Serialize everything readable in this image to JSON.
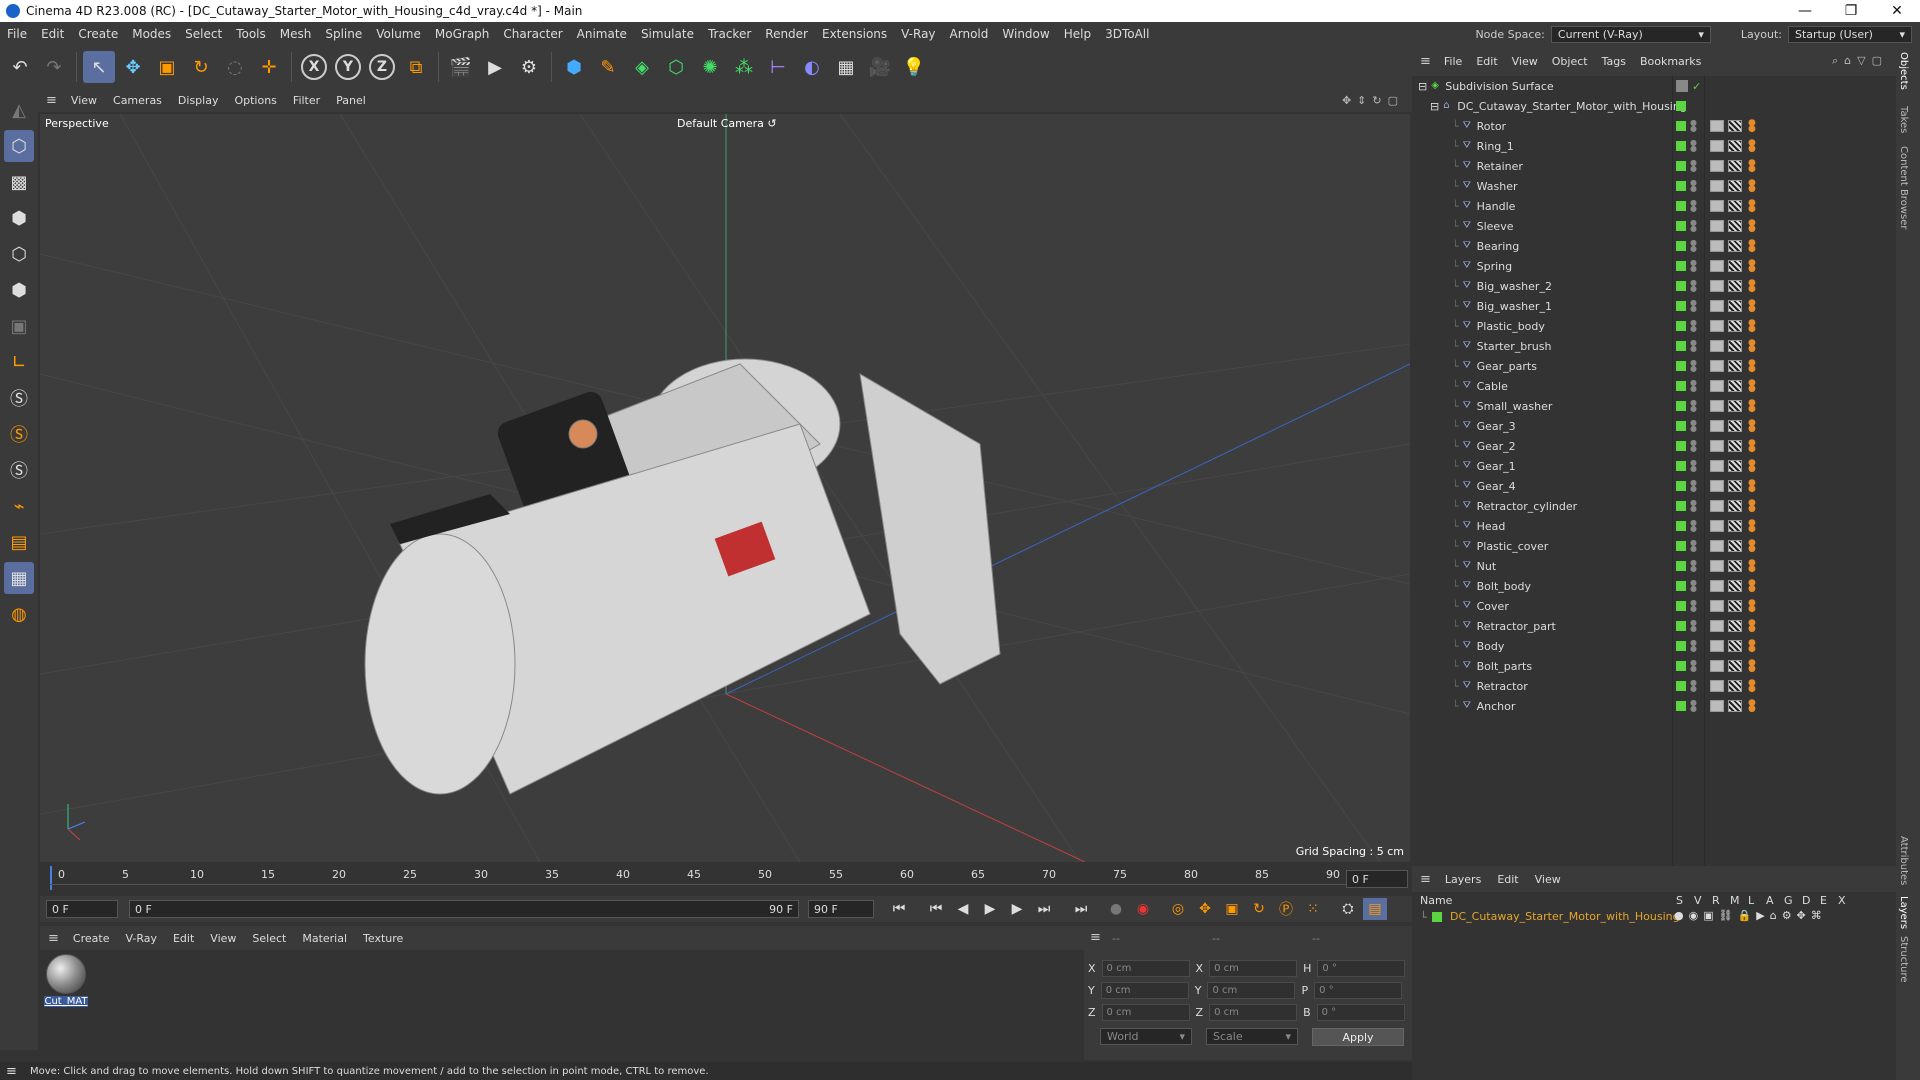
{
  "titlebar": {
    "title": "Cinema 4D R23.008 (RC) - [DC_Cutaway_Starter_Motor_with_Housing_c4d_vray.c4d *] - Main",
    "min": "—",
    "max": "❐",
    "close": "✕"
  },
  "menubar": {
    "items": [
      "File",
      "Edit",
      "Create",
      "Modes",
      "Select",
      "Tools",
      "Mesh",
      "Spline",
      "Volume",
      "MoGraph",
      "Character",
      "Animate",
      "Simulate",
      "Tracker",
      "Render",
      "Extensions",
      "V-Ray",
      "Arnold",
      "Window",
      "Help",
      "3DToAll"
    ],
    "node_space_label": "Node Space:",
    "node_space_value": "Current (V-Ray)",
    "layout_label": "Layout:",
    "layout_value": "Startup (User)"
  },
  "viewport_menu": [
    "View",
    "Cameras",
    "Display",
    "Options",
    "Filter",
    "Panel"
  ],
  "viewport": {
    "label": "Perspective",
    "camera": "Default Camera",
    "grid_spacing": "Grid Spacing : 5 cm"
  },
  "timeline": {
    "ticks": [
      "0",
      "5",
      "10",
      "15",
      "20",
      "25",
      "30",
      "35",
      "40",
      "45",
      "50",
      "55",
      "60",
      "65",
      "70",
      "75",
      "80",
      "85",
      "90"
    ],
    "end_field": "0 F"
  },
  "transport": {
    "start": "0 F",
    "current": "0 F",
    "range_end": "90 F",
    "end": "90 F"
  },
  "material_menu": [
    "Create",
    "V-Ray",
    "Edit",
    "View",
    "Select",
    "Material",
    "Texture"
  ],
  "material": {
    "name": "Cut_MAT"
  },
  "coords": {
    "headers": [
      "--",
      "--",
      "--"
    ],
    "rows": [
      {
        "a": "X",
        "av": "0 cm",
        "b": "X",
        "bv": "0 cm",
        "c": "H",
        "cv": "0 °"
      },
      {
        "a": "Y",
        "av": "0 cm",
        "b": "Y",
        "bv": "0 cm",
        "c": "P",
        "cv": "0 °"
      },
      {
        "a": "Z",
        "av": "0 cm",
        "b": "Z",
        "bv": "0 cm",
        "c": "B",
        "cv": "0 °"
      }
    ],
    "mode": "World",
    "scale": "Scale",
    "apply": "Apply"
  },
  "status": "Move: Click and drag to move elements. Hold down SHIFT to quantize movement / add to the selection in point mode, CTRL to remove.",
  "object_menu": [
    "File",
    "Edit",
    "View",
    "Object",
    "Tags",
    "Bookmarks"
  ],
  "objects": {
    "root": "Subdivision Surface",
    "group": "DC_Cutaway_Starter_Motor_with_Housing",
    "children": [
      "Rotor",
      "Ring_1",
      "Retainer",
      "Washer",
      "Handle",
      "Sleeve",
      "Bearing",
      "Spring",
      "Big_washer_2",
      "Big_washer_1",
      "Plastic_body",
      "Starter_brush",
      "Gear_parts",
      "Cable",
      "Small_washer",
      "Gear_3",
      "Gear_2",
      "Gear_1",
      "Gear_4",
      "Retractor_cylinder",
      "Head",
      "Plastic_cover",
      "Nut",
      "Bolt_body",
      "Cover",
      "Retractor_part",
      "Body",
      "Bolt_parts",
      "Retractor",
      "Anchor"
    ]
  },
  "layers": {
    "menu": [
      "Layers",
      "Edit",
      "View"
    ],
    "name_header": "Name",
    "cols": [
      "S",
      "V",
      "R",
      "M",
      "L",
      "A",
      "G",
      "D",
      "E",
      "X"
    ],
    "rows": [
      "DC_Cutaway_Starter_Motor_with_Housing"
    ]
  },
  "side_tabs": [
    "Objects",
    "Takes",
    "Content Browser",
    "Attributes",
    "Layers",
    "Structure"
  ]
}
